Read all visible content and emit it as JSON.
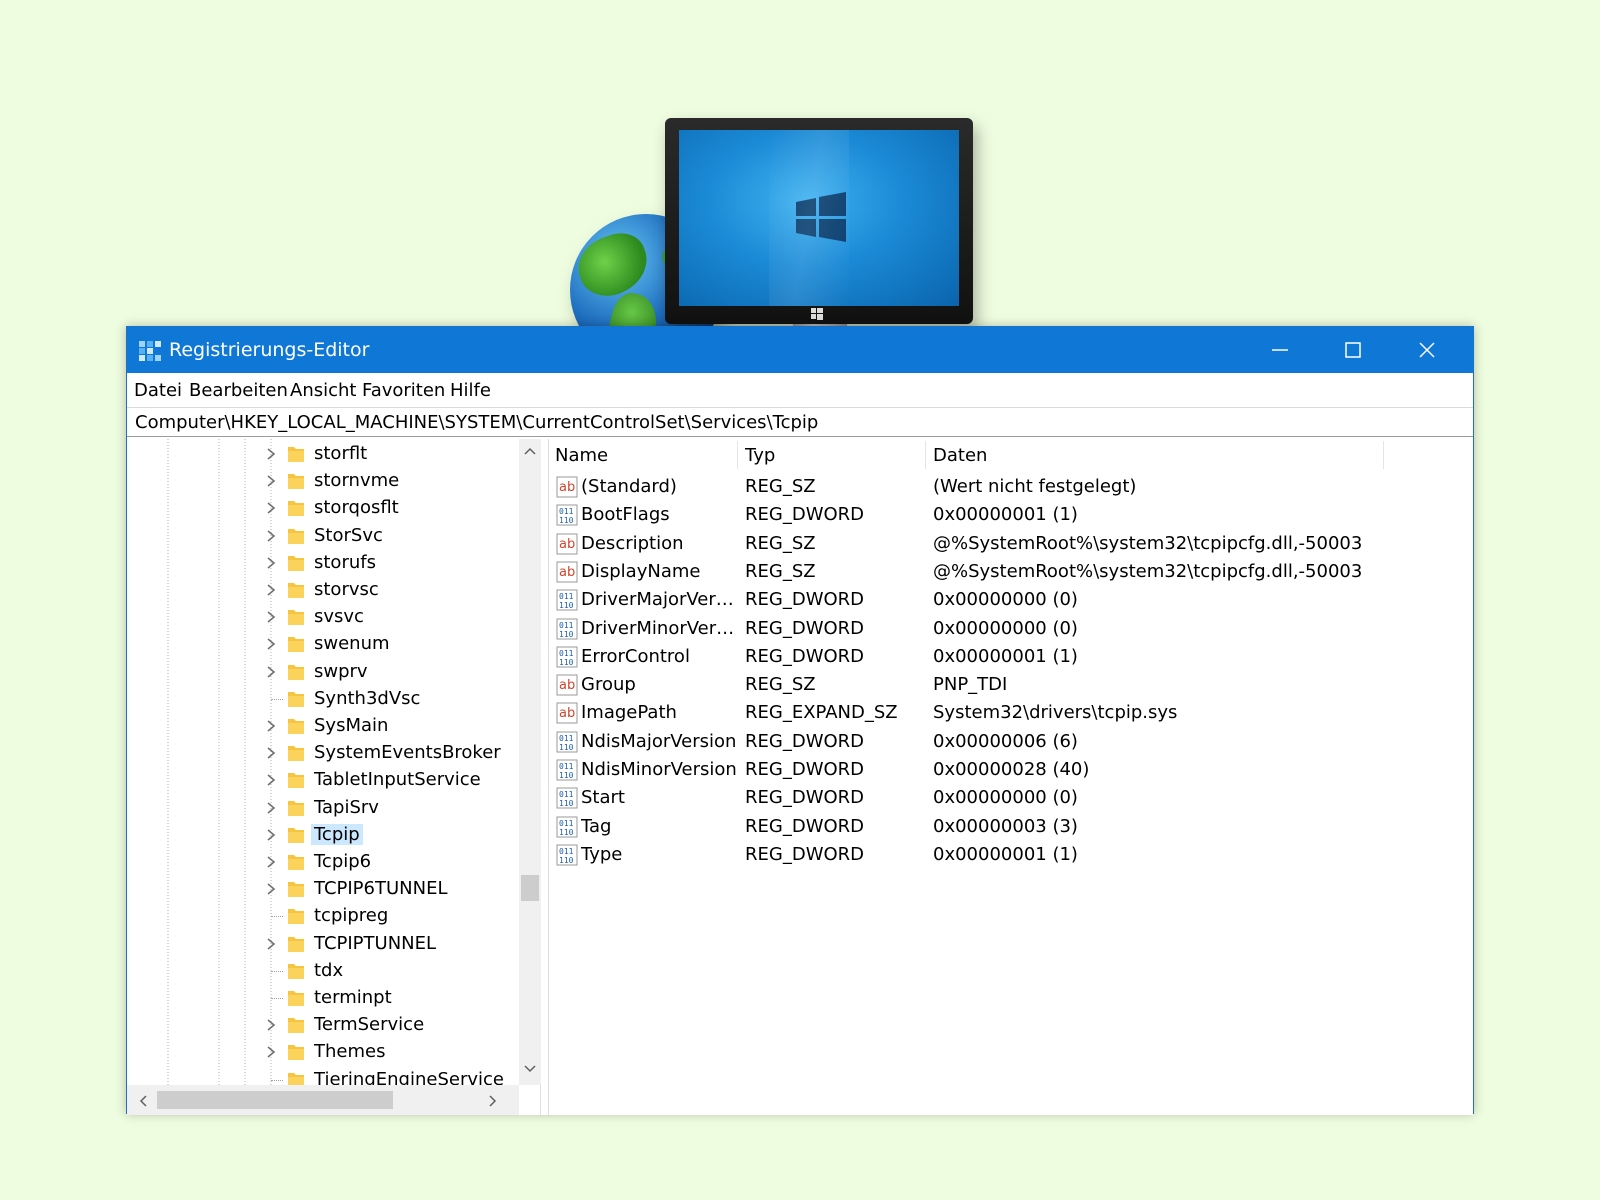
{
  "window": {
    "title": "Registrierungs-Editor",
    "app_icon": "registry-editor-icon",
    "controls": [
      "minimize-icon",
      "maximize-icon",
      "close-icon"
    ]
  },
  "menu": [
    "Datei",
    "Bearbeiten",
    "Ansicht",
    "Favoriten",
    "Hilfe"
  ],
  "address": "Computer\\HKEY_LOCAL_MACHINE\\SYSTEM\\CurrentControlSet\\Services\\Tcpip",
  "tree": {
    "selected": "Tcpip",
    "items": [
      {
        "label": "storflt",
        "expandable": true
      },
      {
        "label": "stornvme",
        "expandable": true
      },
      {
        "label": "storqosflt",
        "expandable": true
      },
      {
        "label": "StorSvc",
        "expandable": true
      },
      {
        "label": "storufs",
        "expandable": true
      },
      {
        "label": "storvsc",
        "expandable": true
      },
      {
        "label": "svsvc",
        "expandable": true
      },
      {
        "label": "swenum",
        "expandable": true
      },
      {
        "label": "swprv",
        "expandable": true
      },
      {
        "label": "Synth3dVsc",
        "expandable": false
      },
      {
        "label": "SysMain",
        "expandable": true
      },
      {
        "label": "SystemEventsBroker",
        "expandable": true
      },
      {
        "label": "TabletInputService",
        "expandable": true
      },
      {
        "label": "TapiSrv",
        "expandable": true
      },
      {
        "label": "Tcpip",
        "expandable": true
      },
      {
        "label": "Tcpip6",
        "expandable": true
      },
      {
        "label": "TCPIP6TUNNEL",
        "expandable": true
      },
      {
        "label": "tcpipreg",
        "expandable": false
      },
      {
        "label": "TCPIPTUNNEL",
        "expandable": true
      },
      {
        "label": "tdx",
        "expandable": false
      },
      {
        "label": "terminpt",
        "expandable": false
      },
      {
        "label": "TermService",
        "expandable": true
      },
      {
        "label": "Themes",
        "expandable": true
      },
      {
        "label": "TieringEngineService",
        "expandable": false
      }
    ]
  },
  "values": {
    "columns": {
      "name": "Name",
      "type": "Typ",
      "data": "Daten"
    },
    "rows": [
      {
        "icon": "string-value-icon",
        "name": "(Standard)",
        "type": "REG_SZ",
        "data": "(Wert nicht festgelegt)"
      },
      {
        "icon": "binary-value-icon",
        "name": "BootFlags",
        "type": "REG_DWORD",
        "data": "0x00000001 (1)"
      },
      {
        "icon": "string-value-icon",
        "name": "Description",
        "type": "REG_SZ",
        "data": "@%SystemRoot%\\system32\\tcpipcfg.dll,-50003"
      },
      {
        "icon": "string-value-icon",
        "name": "DisplayName",
        "type": "REG_SZ",
        "data": "@%SystemRoot%\\system32\\tcpipcfg.dll,-50003"
      },
      {
        "icon": "binary-value-icon",
        "name": "DriverMajorVersi...",
        "type": "REG_DWORD",
        "data": "0x00000000 (0)"
      },
      {
        "icon": "binary-value-icon",
        "name": "DriverMinorVersi...",
        "type": "REG_DWORD",
        "data": "0x00000000 (0)"
      },
      {
        "icon": "binary-value-icon",
        "name": "ErrorControl",
        "type": "REG_DWORD",
        "data": "0x00000001 (1)"
      },
      {
        "icon": "string-value-icon",
        "name": "Group",
        "type": "REG_SZ",
        "data": "PNP_TDI"
      },
      {
        "icon": "string-value-icon",
        "name": "ImagePath",
        "type": "REG_EXPAND_SZ",
        "data": "System32\\drivers\\tcpip.sys"
      },
      {
        "icon": "binary-value-icon",
        "name": "NdisMajorVersion",
        "type": "REG_DWORD",
        "data": "0x00000006 (6)"
      },
      {
        "icon": "binary-value-icon",
        "name": "NdisMinorVersion",
        "type": "REG_DWORD",
        "data": "0x00000028 (40)"
      },
      {
        "icon": "binary-value-icon",
        "name": "Start",
        "type": "REG_DWORD",
        "data": "0x00000000 (0)"
      },
      {
        "icon": "binary-value-icon",
        "name": "Tag",
        "type": "REG_DWORD",
        "data": "0x00000003 (3)"
      },
      {
        "icon": "binary-value-icon",
        "name": "Type",
        "type": "REG_DWORD",
        "data": "0x00000001 (1)"
      }
    ]
  },
  "colors": {
    "background": "#eefcdf",
    "titlebar": "#0f78d7",
    "selection": "#cce8ff",
    "folder": "#f5c542"
  }
}
